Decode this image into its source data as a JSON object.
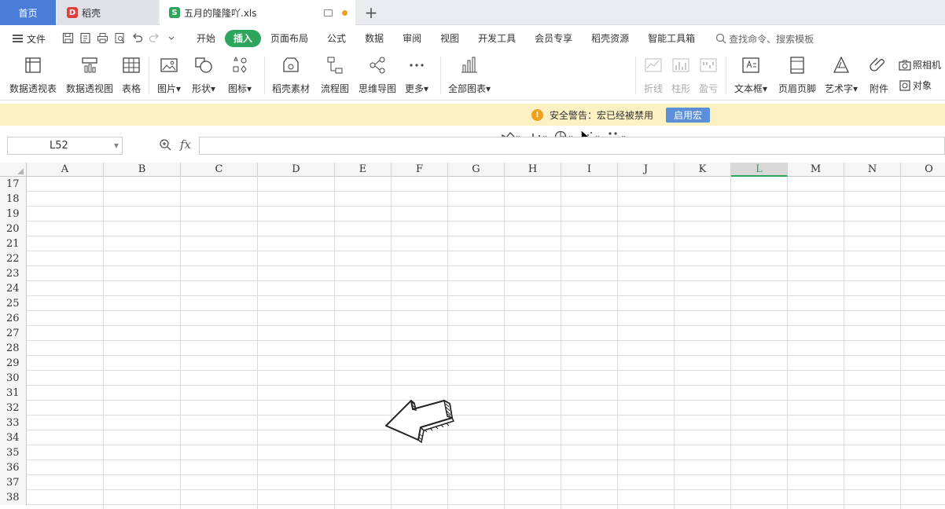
{
  "tabs": {
    "home": "首页",
    "doc": "稻壳",
    "file": "五月的隆隆吖.xls",
    "add": "+"
  },
  "menu": {
    "file": "文件",
    "tabs": [
      "开始",
      "插入",
      "页面布局",
      "公式",
      "数据",
      "审阅",
      "视图",
      "开发工具",
      "会员专享",
      "稻壳资源",
      "智能工具箱"
    ],
    "active_tab": "插入",
    "search": "查找命令、搜索模板"
  },
  "ribbon": {
    "pivot_table": "数据透视表",
    "pivot_chart": "数据透视图",
    "table": "表格",
    "picture": "图片",
    "shape": "形状",
    "icon": "图标",
    "docer_material": "稻壳素材",
    "flowchart": "流程图",
    "mindmap": "思维导图",
    "more": "更多",
    "all_charts": "全部图表",
    "spark_line": "折线",
    "spark_column": "柱形",
    "spark_winloss": "盈亏",
    "textbox": "文本框",
    "header_footer": "页眉页脚",
    "wordart": "艺术字",
    "attachment": "附件",
    "camera": "照相机",
    "object": "对象"
  },
  "warning": {
    "text": "安全警告：宏已经被禁用",
    "button": "启用宏"
  },
  "formula": {
    "namebox": "L52",
    "fx": "fx"
  },
  "columns": [
    "A",
    "B",
    "C",
    "D",
    "E",
    "F",
    "G",
    "H",
    "I",
    "J",
    "K",
    "L",
    "M",
    "N",
    "O"
  ],
  "selected_column": "L",
  "rows": [
    "17",
    "18",
    "19",
    "20",
    "21",
    "22",
    "23",
    "24",
    "25",
    "26",
    "27",
    "28",
    "29",
    "30",
    "31",
    "32",
    "33",
    "34",
    "35",
    "36",
    "37",
    "38"
  ],
  "colors": {
    "accent": "#2da55d",
    "home_tab": "#4a7dd8",
    "warning_bg": "#fdf1c4"
  }
}
